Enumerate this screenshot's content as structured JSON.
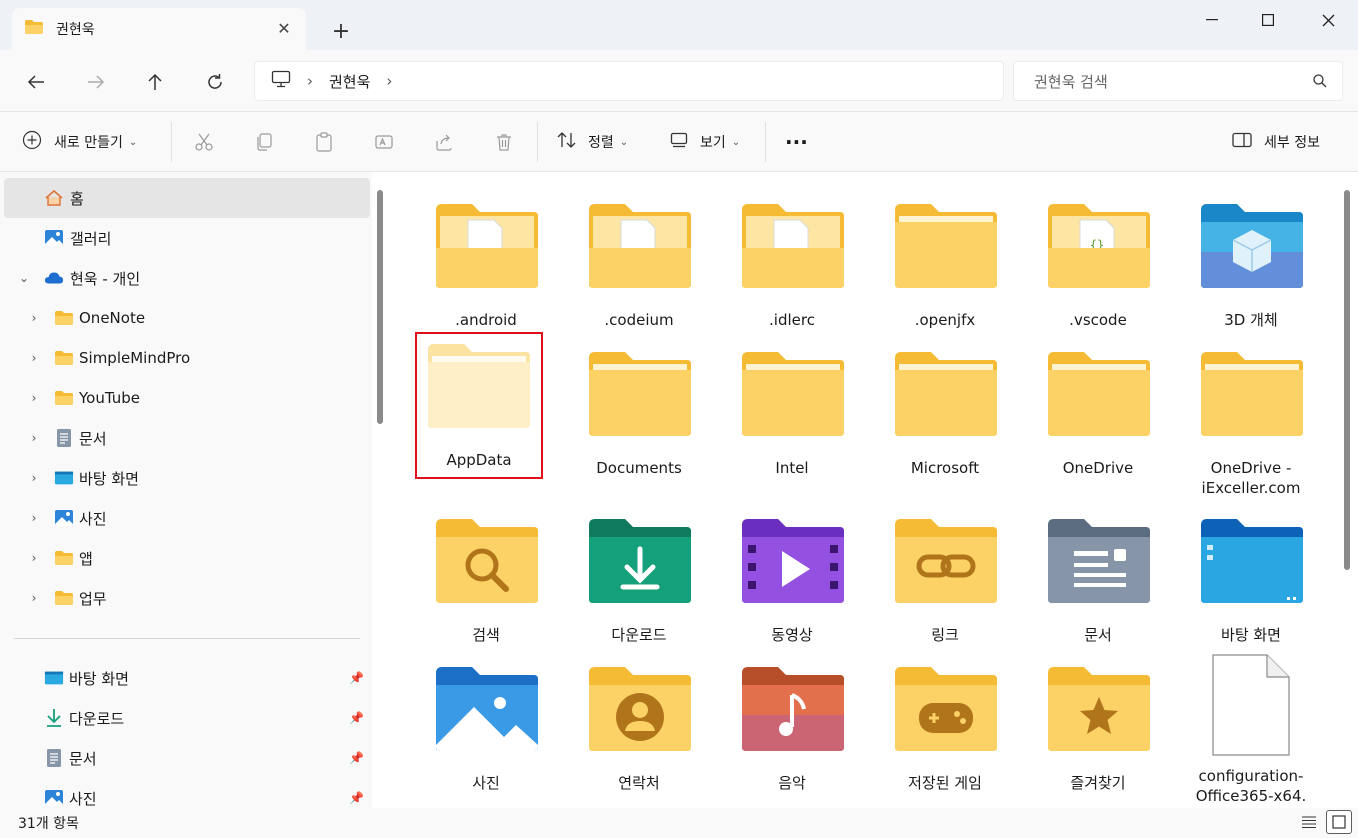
{
  "window": {
    "tab_title": "권현욱",
    "new_tab": "+",
    "minimize": "—",
    "maximize": "☐",
    "close": "✕"
  },
  "nav": {
    "breadcrumb": [
      "권현욱"
    ],
    "search_placeholder": "권현욱 검색"
  },
  "toolbar": {
    "new_label": "새로 만들기",
    "sort_label": "정렬",
    "view_label": "보기",
    "more_label": "···",
    "details_label": "세부 정보"
  },
  "sidebar": {
    "items": [
      {
        "label": "홈",
        "icon": "home-icon"
      },
      {
        "label": "갤러리",
        "icon": "gallery-icon"
      },
      {
        "label": "현욱 - 개인",
        "icon": "onedrive-cloud-icon"
      },
      {
        "label": "OneNote",
        "icon": "folder-icon"
      },
      {
        "label": "SimpleMindPro",
        "icon": "folder-icon"
      },
      {
        "label": "YouTube",
        "icon": "folder-icon"
      },
      {
        "label": "문서",
        "icon": "document-icon"
      },
      {
        "label": "바탕 화면",
        "icon": "desktop-icon"
      },
      {
        "label": "사진",
        "icon": "pictures-icon"
      },
      {
        "label": "앱",
        "icon": "folder-icon"
      },
      {
        "label": "업무",
        "icon": "folder-icon"
      }
    ],
    "quick_access": [
      {
        "label": "바탕 화면",
        "icon": "desktop-icon"
      },
      {
        "label": "다운로드",
        "icon": "download-icon"
      },
      {
        "label": "문서",
        "icon": "document-icon"
      },
      {
        "label": "사진",
        "icon": "pictures-icon"
      }
    ]
  },
  "files": [
    {
      "name": ".android",
      "type": "folder-doc"
    },
    {
      "name": ".codeium",
      "type": "folder-doc"
    },
    {
      "name": ".idlerc",
      "type": "folder-doc"
    },
    {
      "name": ".openjfx",
      "type": "folder"
    },
    {
      "name": ".vscode",
      "type": "folder-code"
    },
    {
      "name": "3D 개체",
      "type": "objects3d"
    },
    {
      "name": "AppData",
      "type": "folder-hidden"
    },
    {
      "name": "Documents",
      "type": "folder"
    },
    {
      "name": "Intel",
      "type": "folder"
    },
    {
      "name": "Microsoft",
      "type": "folder"
    },
    {
      "name": "OneDrive",
      "type": "folder"
    },
    {
      "name": "OneDrive -\niExceller.com",
      "type": "folder"
    },
    {
      "name": "검색",
      "type": "search-folder"
    },
    {
      "name": "다운로드",
      "type": "downloads-folder"
    },
    {
      "name": "동영상",
      "type": "videos-folder"
    },
    {
      "name": "링크",
      "type": "links-folder"
    },
    {
      "name": "문서",
      "type": "documents-folder"
    },
    {
      "name": "바탕 화면",
      "type": "desktop-folder"
    },
    {
      "name": "사진",
      "type": "pictures-folder"
    },
    {
      "name": "연락처",
      "type": "contacts-folder"
    },
    {
      "name": "음악",
      "type": "music-folder"
    },
    {
      "name": "저장된 게임",
      "type": "games-folder"
    },
    {
      "name": "즐겨찾기",
      "type": "favorites-folder"
    },
    {
      "name": "configuration-\nOffice365-x64.",
      "type": "file"
    }
  ],
  "status": {
    "item_count": "31개 항목"
  },
  "colors": {
    "folder_yellow": "#f8c74a",
    "folder_light": "#fde39b",
    "selection_red": "#e0101a",
    "accent": "#0067c0"
  }
}
